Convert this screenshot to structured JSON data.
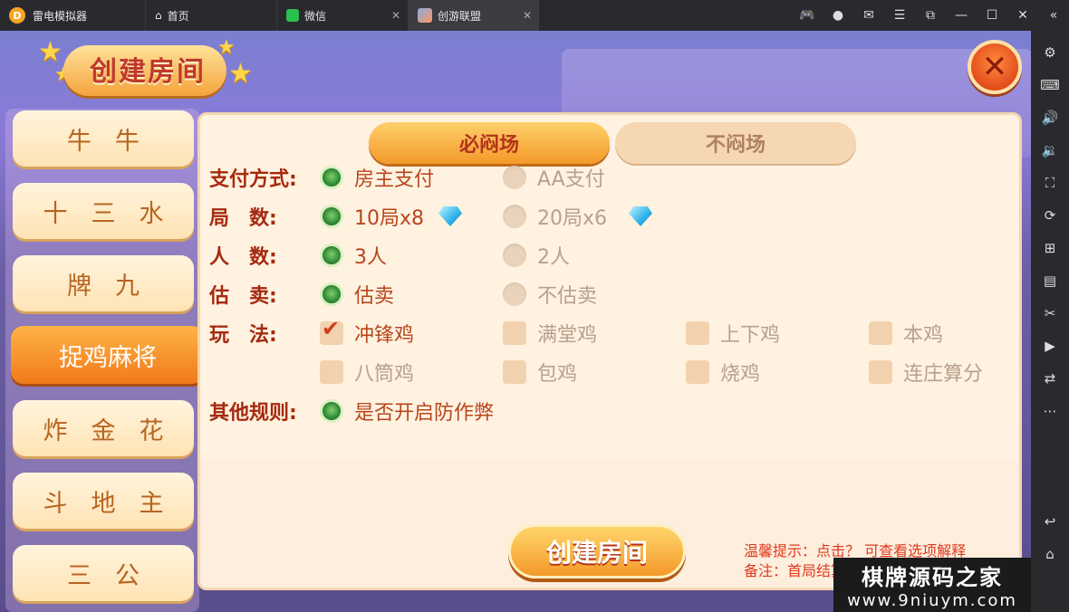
{
  "titlebar": {
    "app_name": "雷电模拟器",
    "tabs": [
      {
        "label": "首页",
        "icon": "home-icon"
      },
      {
        "label": "微信",
        "icon": "wechat-icon"
      },
      {
        "label": "创游联盟",
        "icon": "game-icon"
      }
    ]
  },
  "banner": {
    "title": "创建房间"
  },
  "menu": {
    "items": [
      {
        "label": "牛牛"
      },
      {
        "label": "十三水"
      },
      {
        "label": "牌九"
      },
      {
        "label": "捉鸡麻将",
        "active": true
      },
      {
        "label": "炸金花"
      },
      {
        "label": "斗地主"
      },
      {
        "label": "三公"
      }
    ]
  },
  "panel": {
    "tabs": [
      {
        "label": "必闷场",
        "active": true
      },
      {
        "label": "不闷场",
        "active": false
      }
    ],
    "rows": [
      {
        "label": "支付方式:",
        "options": [
          {
            "text": "房主支付",
            "selected": true
          },
          {
            "text": "AA支付",
            "selected": false
          }
        ]
      },
      {
        "label": "局　数:",
        "options": [
          {
            "text": "10局x8",
            "selected": true
          },
          {
            "text": "20局x6",
            "selected": false
          }
        ]
      },
      {
        "label": "人　数:",
        "options": [
          {
            "text": "3人",
            "selected": true
          },
          {
            "text": "2人",
            "selected": false
          }
        ]
      },
      {
        "label": "估　卖:",
        "options": [
          {
            "text": "估卖",
            "selected": true
          },
          {
            "text": "不估卖",
            "selected": false
          }
        ]
      },
      {
        "label": "玩　法:",
        "options": [
          {
            "text": "冲锋鸡",
            "checked": true
          },
          {
            "text": "满堂鸡",
            "checked": false
          },
          {
            "text": "上下鸡",
            "checked": false
          },
          {
            "text": "本鸡",
            "checked": false
          }
        ]
      },
      {
        "label": "",
        "options": [
          {
            "text": "八筒鸡",
            "checked": false
          },
          {
            "text": "包鸡",
            "checked": false
          },
          {
            "text": "烧鸡",
            "checked": false
          },
          {
            "text": "连庄算分",
            "checked": false
          }
        ]
      },
      {
        "label": "其他规则:",
        "options": [
          {
            "text": "是否开启防作弊",
            "selected": true
          }
        ]
      }
    ],
    "create_button": "创建房间",
    "hint_1": "温馨提示：点击？ 可查看选项解释",
    "hint_2": "备注：首局结算前"
  },
  "watermark": {
    "line1": "棋牌源码之家",
    "line2": "www.9niuym.com"
  }
}
